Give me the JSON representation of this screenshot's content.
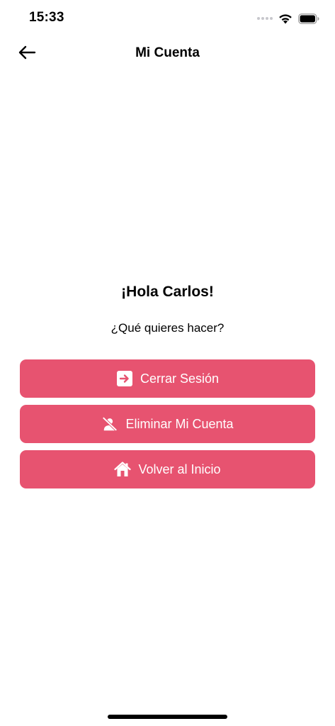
{
  "status_bar": {
    "time": "15:33",
    "icons": [
      "signal-dots-icon",
      "wifi-icon",
      "battery-icon"
    ]
  },
  "nav": {
    "back_icon": "arrow-left-icon",
    "title": "Mi Cuenta"
  },
  "main": {
    "greeting": "¡Hola Carlos!",
    "prompt": "¿Qué quieres hacer?",
    "buttons": [
      {
        "label": "Cerrar Sesión",
        "icon": "logout-arrow-icon"
      },
      {
        "label": "Eliminar Mi Cuenta",
        "icon": "user-slash-icon"
      },
      {
        "label": "Volver al Inicio",
        "icon": "home-icon"
      }
    ]
  },
  "colors": {
    "accent": "#e75370",
    "background": "#ffffff",
    "text": "#000000"
  }
}
